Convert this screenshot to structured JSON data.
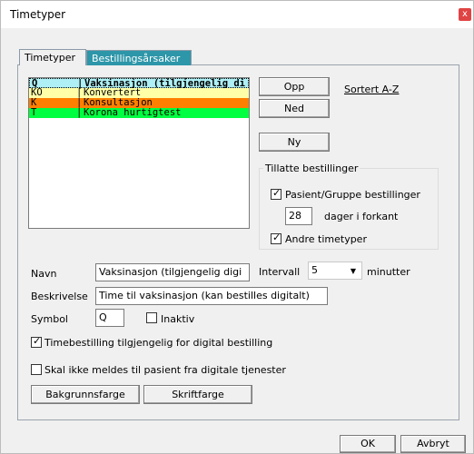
{
  "window": {
    "title": "Timetyper",
    "close_glyph": "x"
  },
  "tabs": [
    {
      "label": "Timetyper",
      "active": true
    },
    {
      "label": "Bestillingsårsaker",
      "active": false
    }
  ],
  "appointment_list": {
    "rows": [
      {
        "code": "Q",
        "name": "Vaksinasjon (tilgjengelig di",
        "color": "#aef0f5",
        "selected": true
      },
      {
        "code": "KO",
        "name": "Konvertert",
        "color": "#ffffa8"
      },
      {
        "code": "K",
        "name": "Konsultasjon",
        "color": "#ff7f00"
      },
      {
        "code": "T",
        "name": "Korona hurtigtest",
        "color": "#00ff40"
      }
    ],
    "separator": "|"
  },
  "buttons": {
    "up": "Opp",
    "down": "Ned",
    "new": "Ny",
    "background_color": "Bakgrunnsfarge",
    "font_color": "Skriftfarge",
    "ok": "OK",
    "cancel": "Avbryt"
  },
  "sort_link": "Sortert A-Z",
  "allowed_bookings": {
    "title": "Tillatte bestillinger",
    "patient_group": {
      "label": "Pasient/Gruppe bestillinger",
      "checked": true
    },
    "days_value": "28",
    "days_label": "dager i forkant",
    "other_types": {
      "label": "Andre timetyper",
      "checked": true
    }
  },
  "form": {
    "name_label": "Navn",
    "name_value": "Vaksinasjon (tilgjengelig digi",
    "interval_label": "Intervall",
    "interval_value": "5",
    "interval_unit": "minutter",
    "description_label": "Beskrivelse",
    "description_value": "Time til vaksinasjon (kan bestilles digitalt)",
    "symbol_label": "Symbol",
    "symbol_value": "Q",
    "inactive_label": "Inaktiv",
    "inactive_checked": false,
    "digital_booking": {
      "label": "Timebestilling tilgjengelig for digital bestilling",
      "checked": true
    },
    "no_report": {
      "label": "Skal ikke meldes til pasient fra digitale tjenester",
      "checked": false
    }
  },
  "colors": {
    "tab_inactive": "#2d96a9",
    "close": "#e04343"
  }
}
